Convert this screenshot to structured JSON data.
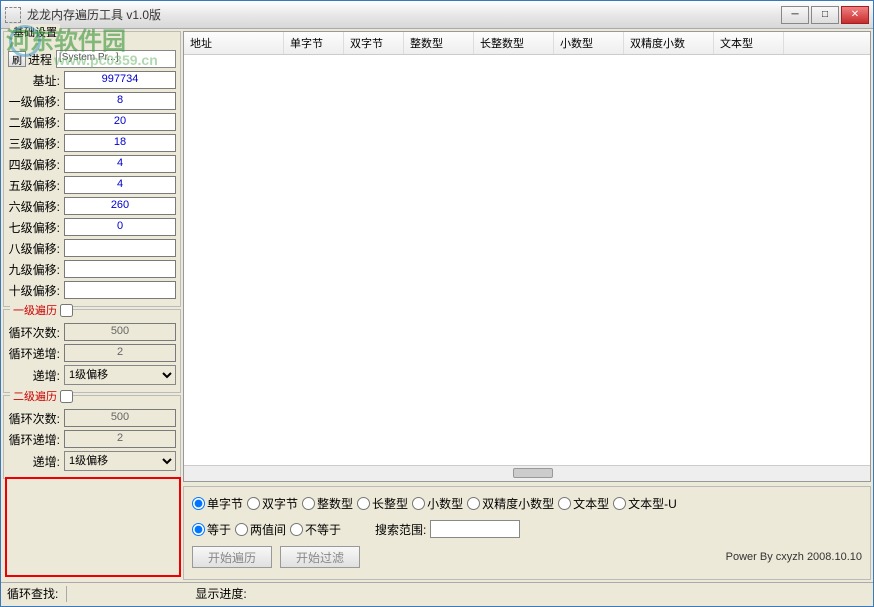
{
  "window": {
    "title": "龙龙内存遍历工具 v1.0版"
  },
  "watermark": {
    "text": "河东软件园",
    "url": "www.pc0359.cn"
  },
  "base_group": {
    "title": "基础设置",
    "refresh": "刷",
    "proc_label": "进程",
    "proc_value": "[System Pr...]",
    "rows": [
      {
        "label": "基址:",
        "value": "997734"
      },
      {
        "label": "一级偏移:",
        "value": "8"
      },
      {
        "label": "二级偏移:",
        "value": "20"
      },
      {
        "label": "三级偏移:",
        "value": "18"
      },
      {
        "label": "四级偏移:",
        "value": "4"
      },
      {
        "label": "五级偏移:",
        "value": "4"
      },
      {
        "label": "六级偏移:",
        "value": "260"
      },
      {
        "label": "七级偏移:",
        "value": "0"
      },
      {
        "label": "八级偏移:",
        "value": ""
      },
      {
        "label": "九级偏移:",
        "value": ""
      },
      {
        "label": "十级偏移:",
        "value": ""
      }
    ]
  },
  "lv1": {
    "title": "一级遍历",
    "count_label": "循环次数:",
    "count": "500",
    "inc_label": "循环递增:",
    "inc": "2",
    "step_label": "递增:",
    "step_option": "1级偏移"
  },
  "lv2": {
    "title": "二级遍历",
    "count_label": "循环次数:",
    "count": "500",
    "inc_label": "循环递增:",
    "inc": "2",
    "step_label": "递增:",
    "step_option": "1级偏移"
  },
  "table": {
    "headers": [
      "地址",
      "单字节",
      "双字节",
      "整数型",
      "长整数型",
      "小数型",
      "双精度小数",
      "文本型"
    ]
  },
  "search": {
    "types": [
      "单字节",
      "双字节",
      "整数型",
      "长整型",
      "小数型",
      "双精度小数型",
      "文本型",
      "文本型-U"
    ],
    "ops": [
      "等于",
      "两值间",
      "不等于"
    ],
    "range_label": "搜索范围:",
    "btn_start": "开始遍历",
    "btn_filter": "开始过滤",
    "credit": "Power By cxyzh 2008.10.10"
  },
  "status": {
    "find": "循环查找:",
    "progress": "显示进度:"
  }
}
